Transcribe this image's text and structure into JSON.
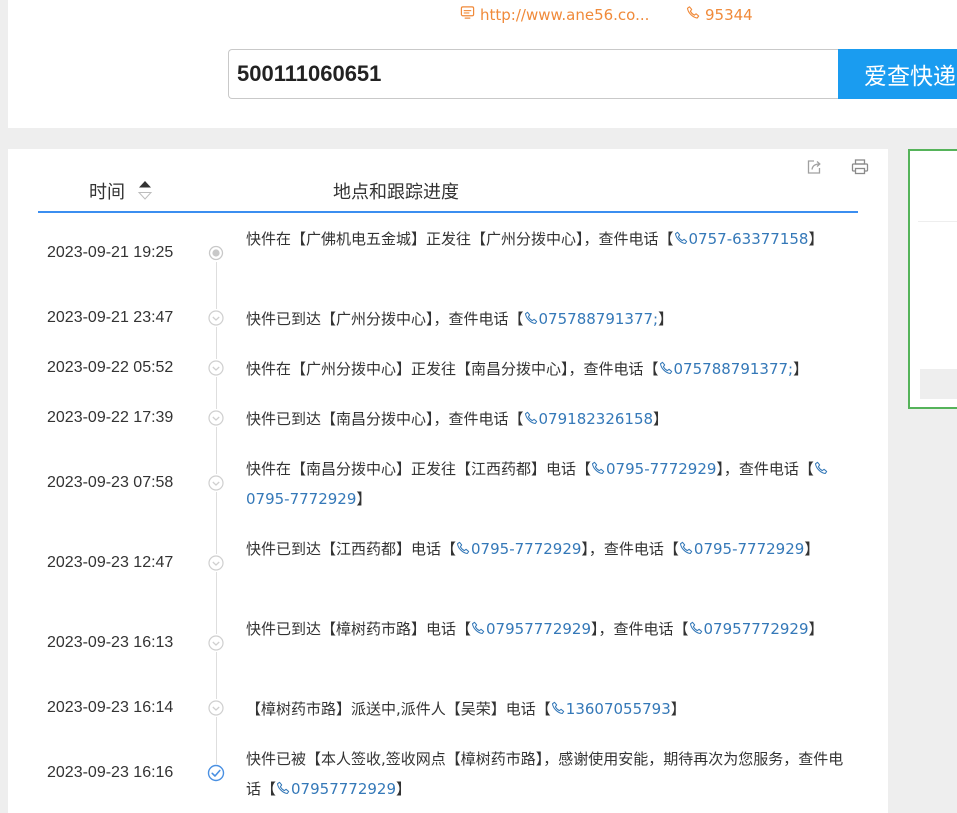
{
  "header": {
    "website": "http://www.ane56.co...",
    "hotline": "95344",
    "tracking_number": "500111060651",
    "search_button": "爱查快递"
  },
  "table": {
    "col_time": "时间",
    "col_location": "地点和跟踪进度"
  },
  "records": [
    {
      "time": "2023-09-21 19:25",
      "parts": [
        {
          "t": "快件在【广佛机电五金城】正发往【广州分拨中心】，查件电话【"
        },
        {
          "p": "0757-63377158"
        },
        {
          "t": "】"
        }
      ]
    },
    {
      "time": "2023-09-21 23:47",
      "parts": [
        {
          "t": "快件已到达【广州分拨中心】，查件电话【"
        },
        {
          "p": "075788791377;"
        },
        {
          "t": "】"
        }
      ]
    },
    {
      "time": "2023-09-22 05:52",
      "parts": [
        {
          "t": "快件在【广州分拨中心】正发往【南昌分拨中心】，查件电话【"
        },
        {
          "p": "075788791377;"
        },
        {
          "t": "】"
        }
      ]
    },
    {
      "time": "2023-09-22 17:39",
      "parts": [
        {
          "t": "快件已到达【南昌分拨中心】，查件电话【"
        },
        {
          "p": "079182326158"
        },
        {
          "t": "】"
        }
      ]
    },
    {
      "time": "2023-09-23 07:58",
      "parts": [
        {
          "t": "快件在【南昌分拨中心】正发往【江西药都】电话【"
        },
        {
          "p": "0795-7772929"
        },
        {
          "t": "】，查件电话【"
        },
        {
          "p": "0795-7772929"
        },
        {
          "t": "】"
        }
      ]
    },
    {
      "time": "2023-09-23 12:47",
      "parts": [
        {
          "t": "快件已到达【江西药都】电话【"
        },
        {
          "p": "0795-7772929"
        },
        {
          "t": "】，查件电话【"
        },
        {
          "p": "0795-7772929"
        },
        {
          "t": "】"
        }
      ]
    },
    {
      "time": "2023-09-23 16:13",
      "parts": [
        {
          "t": "快件已到达【樟树药市路】电话【"
        },
        {
          "p": "07957772929"
        },
        {
          "t": "】，查件电话【"
        },
        {
          "p": "07957772929"
        },
        {
          "t": "】"
        }
      ]
    },
    {
      "time": "2023-09-23 16:14",
      "parts": [
        {
          "t": "【樟树药市路】派送中,派件人【吴荣】电话【"
        },
        {
          "p": "13607055793"
        },
        {
          "t": "】"
        }
      ]
    },
    {
      "time": "2023-09-23 16:16",
      "parts": [
        {
          "t": "快件已被【本人签收,签收网点【樟树药市路】，感谢使用安能，期待再次为您服务，查件电话【"
        },
        {
          "p": "07957772929"
        },
        {
          "t": "】"
        }
      ]
    }
  ],
  "colors": {
    "accent_blue": "#1a9cf0",
    "link_blue": "#3478b8",
    "contact_orange": "#f08a3a",
    "sign_green": "#55b35a"
  }
}
